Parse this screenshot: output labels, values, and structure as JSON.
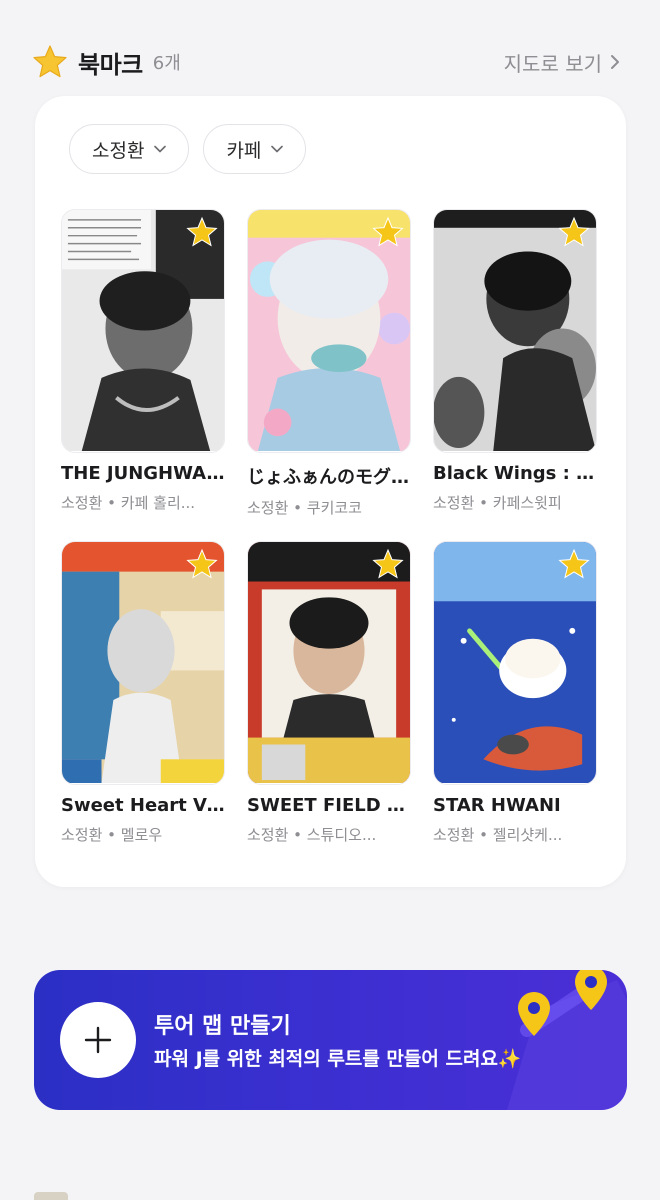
{
  "header": {
    "icon": "star-icon",
    "title": "북마크",
    "count": "6개",
    "map_link": "지도로 보기"
  },
  "filters": [
    {
      "label": "소정환"
    },
    {
      "label": "카페"
    }
  ],
  "items": [
    {
      "title": "THE JUNGHWA...",
      "subtitle": "소정환 • 카페 홀리..."
    },
    {
      "title": "じょふぁんのモグ...",
      "subtitle": "소정환 • 쿠키코코"
    },
    {
      "title": "Black Wings : Y...",
      "subtitle": "소정환 • 카페스윗피"
    },
    {
      "title": "Sweet Heart Vi...",
      "subtitle": "소정환 • 멜로우"
    },
    {
      "title": "SWEET FIELD D...",
      "subtitle": "소정환 • 스튜디오..."
    },
    {
      "title": "STAR HWANI",
      "subtitle": "소정환 • 젤리샷케..."
    }
  ],
  "banner": {
    "title": "투어 맵 만들기",
    "subtitle": "파워 J를 위한 최적의 루트를 만들어 드려요✨"
  },
  "colors": {
    "accent": "#3a2fd0",
    "star": "#f5c518",
    "muted": "#8e8e93"
  }
}
